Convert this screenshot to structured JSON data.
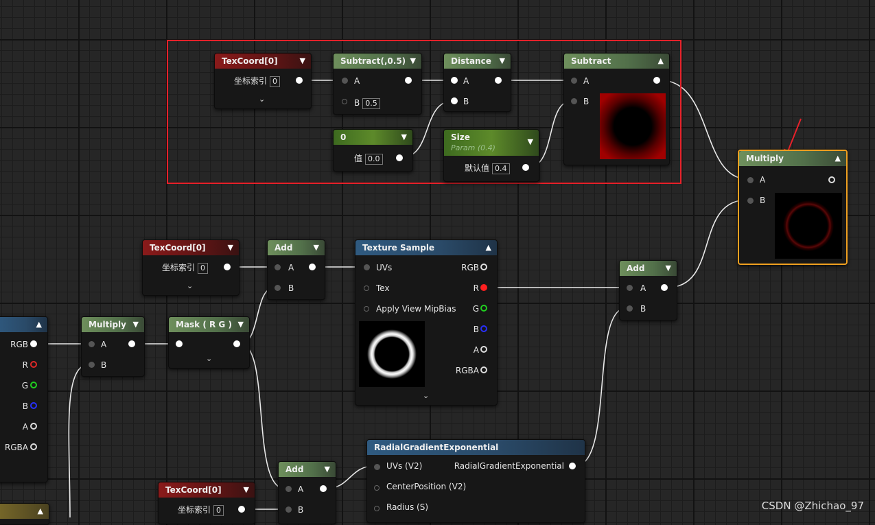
{
  "top": {
    "texcoord": {
      "title": "TexCoord[0]",
      "param_label": "坐标索引",
      "param_value": "0"
    },
    "subtract05": {
      "title": "Subtract(,0.5)",
      "pin_a": "A",
      "pin_b": "B",
      "b_value": "0.5"
    },
    "distance": {
      "title": "Distance",
      "pin_a": "A",
      "pin_b": "B"
    },
    "subtract": {
      "title": "Subtract",
      "pin_a": "A",
      "pin_b": "B"
    },
    "const0": {
      "title": "0",
      "param_label": "值",
      "param_value": "0.0"
    },
    "size": {
      "title": "Size",
      "subtitle": "Param (0.4)",
      "param_label": "默认值",
      "param_value": "0.4"
    },
    "multiply": {
      "title": "Multiply",
      "pin_a": "A",
      "pin_b": "B"
    }
  },
  "bottom": {
    "texcoord1": {
      "title": "TexCoord[0]",
      "param_label": "坐标索引",
      "param_value": "0"
    },
    "add1": {
      "title": "Add",
      "pin_a": "A",
      "pin_b": "B"
    },
    "texture_sample": {
      "title": "Texture Sample",
      "in_uvs": "UVs",
      "in_tex": "Tex",
      "in_mip": "Apply View MipBias",
      "out_rgb": "RGB",
      "out_r": "R",
      "out_g": "G",
      "out_b": "B",
      "out_a": "A",
      "out_rgba": "RGBA"
    },
    "add2": {
      "title": "Add",
      "pin_a": "A",
      "pin_b": "B"
    },
    "left_partial": {
      "out_rgb": "RGB",
      "out_r": "R",
      "out_g": "G",
      "out_b": "B",
      "out_a": "A",
      "out_rgba": "RGBA"
    },
    "multiply2": {
      "title": "Multiply",
      "pin_a": "A",
      "pin_b": "B"
    },
    "mask": {
      "title": "Mask ( R G )"
    },
    "radial": {
      "title": "RadialGradientExponential",
      "in_uvs": "UVs (V2)",
      "in_center": "CenterPosition (V2)",
      "in_radius": "Radius (S)",
      "out": "RadialGradientExponential"
    },
    "add3": {
      "title": "Add",
      "pin_a": "A",
      "pin_b": "B"
    },
    "texcoord2": {
      "title": "TexCoord[0]",
      "param_label": "坐标索引",
      "param_value": "0"
    }
  },
  "watermark": "CSDN @Zhichao_97",
  "colors": {
    "selection_box": "#e8212a",
    "selected_node": "#f0a020",
    "annotation_arrow": "#e8212a"
  },
  "icons": {
    "collapse": "chevron-up-icon",
    "expand": "chevron-down-icon"
  }
}
